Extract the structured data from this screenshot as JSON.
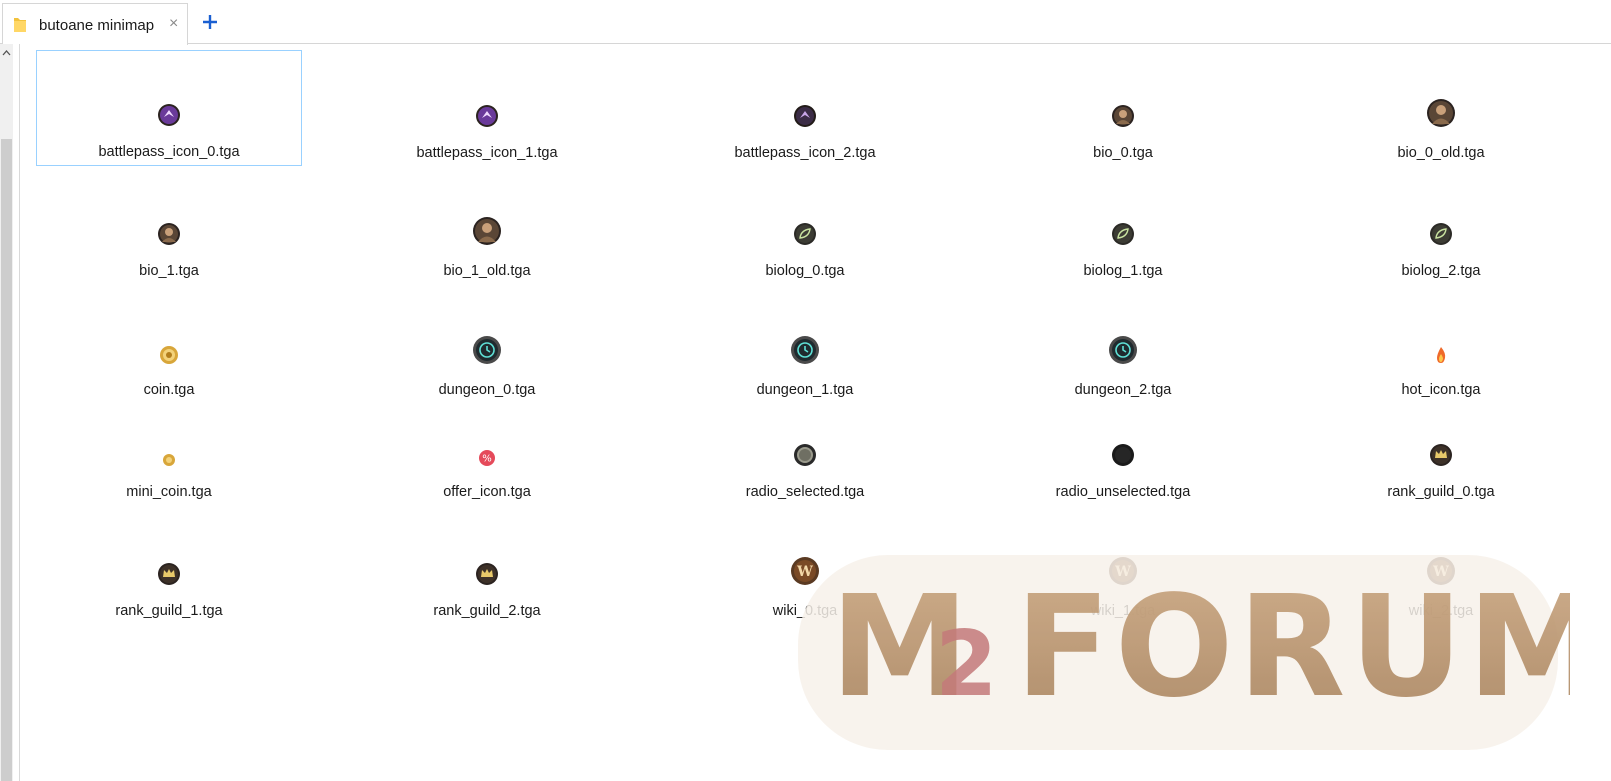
{
  "tab": {
    "title": "butoane minimap",
    "close_glyph": "×",
    "new_tab_glyph": "+"
  },
  "files": [
    {
      "name": "battlepass_icon_0.tga",
      "icon": "battlepass-icon",
      "selected": true
    },
    {
      "name": "battlepass_icon_1.tga",
      "icon": "battlepass-icon"
    },
    {
      "name": "battlepass_icon_2.tga",
      "icon": "battlepass-icon-dark"
    },
    {
      "name": "bio_0.tga",
      "icon": "bio-portrait-icon"
    },
    {
      "name": "bio_0_old.tga",
      "icon": "bio-portrait-icon-large"
    },
    {
      "name": "bio_1.tga",
      "icon": "bio-portrait-icon"
    },
    {
      "name": "bio_1_old.tga",
      "icon": "bio-portrait-icon-large"
    },
    {
      "name": "biolog_0.tga",
      "icon": "leaf-icon"
    },
    {
      "name": "biolog_1.tga",
      "icon": "leaf-icon"
    },
    {
      "name": "biolog_2.tga",
      "icon": "leaf-icon"
    },
    {
      "name": "coin.tga",
      "icon": "coin-icon"
    },
    {
      "name": "dungeon_0.tga",
      "icon": "clock-icon"
    },
    {
      "name": "dungeon_1.tga",
      "icon": "clock-icon"
    },
    {
      "name": "dungeon_2.tga",
      "icon": "clock-icon"
    },
    {
      "name": "hot_icon.tga",
      "icon": "flame-icon"
    },
    {
      "name": "mini_coin.tga",
      "icon": "mini-coin-icon"
    },
    {
      "name": "offer_icon.tga",
      "icon": "offer-percent-icon"
    },
    {
      "name": "radio_selected.tga",
      "icon": "radio-selected-icon"
    },
    {
      "name": "radio_unselected.tga",
      "icon": "radio-unselected-icon"
    },
    {
      "name": "rank_guild_0.tga",
      "icon": "crown-icon"
    },
    {
      "name": "rank_guild_1.tga",
      "icon": "crown-icon"
    },
    {
      "name": "rank_guild_2.tga",
      "icon": "crown-icon"
    },
    {
      "name": "wiki_0.tga",
      "icon": "wiki-w-icon"
    },
    {
      "name": "wiki_1.tga",
      "icon": "wiki-w-icon"
    },
    {
      "name": "wiki_2.tga",
      "icon": "wiki-w-icon"
    }
  ],
  "watermark": {
    "text_left": "M",
    "text_badge": "2",
    "text_right": "FORUM"
  },
  "colors": {
    "selection_border": "#99d1ff",
    "accent_blue": "#1a5fd1",
    "folder_yellow": "#f2c23d"
  }
}
